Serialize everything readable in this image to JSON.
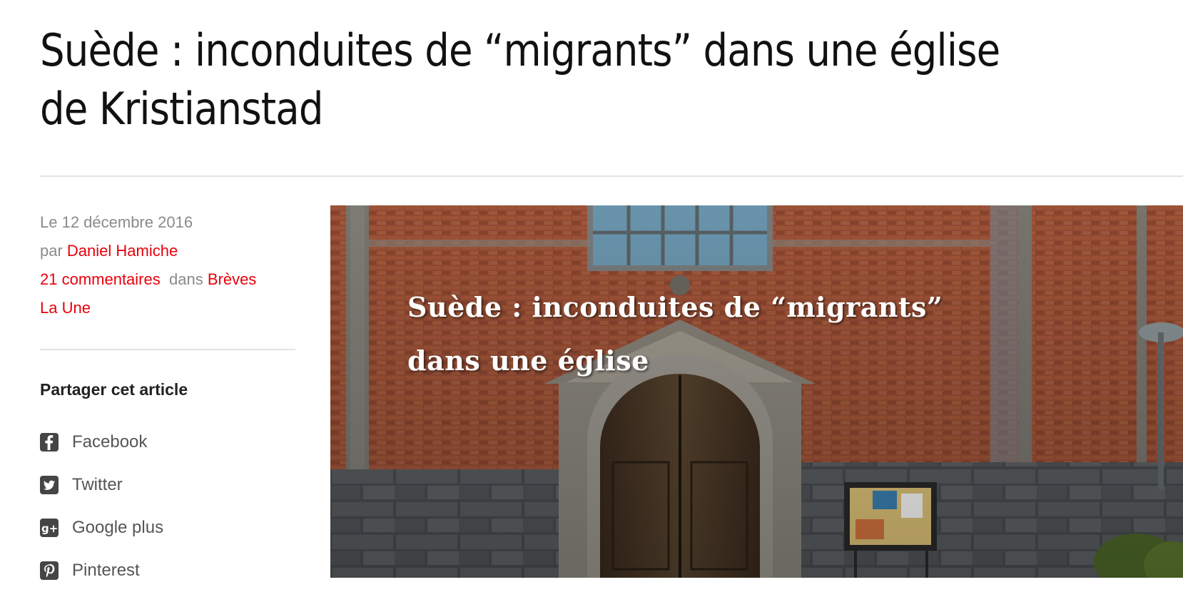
{
  "article": {
    "title": "Suède : inconduites de “migrants” dans une église de Kristianstad"
  },
  "meta": {
    "date": "Le 12 décembre 2016",
    "by_prefix": "par",
    "author": "Daniel Hamiche",
    "comments": "21 commentaires",
    "in_prefix": "dans",
    "categories": [
      "Brèves",
      "La Une"
    ]
  },
  "share": {
    "heading": "Partager cet article",
    "items": [
      {
        "label": "Facebook",
        "icon": "facebook-icon"
      },
      {
        "label": "Twitter",
        "icon": "twitter-icon"
      },
      {
        "label": "Google plus",
        "icon": "google-plus-icon"
      },
      {
        "label": "Pinterest",
        "icon": "pinterest-icon"
      }
    ]
  },
  "featured_image": {
    "overlay_line1": "Suède : inconduites de “migrants”",
    "overlay_line2": "dans une église"
  },
  "colors": {
    "link": "#e8000b",
    "meta_text": "#8a8a8a",
    "icon_bg": "#454545"
  }
}
